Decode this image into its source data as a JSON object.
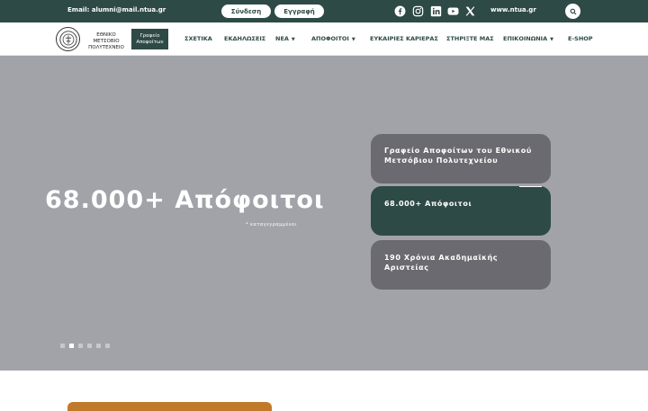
{
  "topbar": {
    "email": "Email: alumni@mail.ntua.gr",
    "login_label": "Σύνδεση",
    "register_label": "Εγγραφή",
    "social_icons": [
      "facebook-icon",
      "instagram-icon",
      "linkedin-icon",
      "youtube-icon",
      "x-icon"
    ],
    "website": "www.ntua.gr"
  },
  "logo": {
    "line1": "ΕΘΝΙΚΟ ΜΕΤΣΟΒΙΟ",
    "line2": "ΠΟΛΥΤΕΧΝΕΙΟ",
    "badge_line1": "Γραφείο",
    "badge_line2": "Αποφοίτων"
  },
  "nav": {
    "items": [
      {
        "label": "ΣΧΕΤΙΚΑ",
        "dropdown": false
      },
      {
        "label": "ΕΚΔΗΛΩΣΕΙΣ",
        "dropdown": false
      },
      {
        "label": "ΝΕΑ",
        "dropdown": true
      },
      {
        "label": "ΑΠΟΦΟΙΤΟΙ",
        "dropdown": true
      },
      {
        "label": "ΕΥΚΑΙΡΙΕΣ ΚΑΡΙΕΡΑΣ",
        "dropdown": false
      },
      {
        "label": "ΣΤΗΡΙΞΤΕ ΜΑΣ",
        "dropdown": false
      },
      {
        "label": "ΕΠΙΚΟΙΝΩΝΙΑ",
        "dropdown": true
      },
      {
        "label": "E-SHOP",
        "dropdown": false
      }
    ],
    "caret": "▼"
  },
  "hero": {
    "title": "68.000+ Απόφοιτοι",
    "note": "* καταγεγραμμένοι",
    "slide_count": 6,
    "active_slide": 2,
    "cards": [
      {
        "text": "Γραφείο Αποφοίτων του Εθνικού Μετσόβιου Πολυτεχνείου",
        "active": false
      },
      {
        "text": "68.000+ Απόφοιτοι",
        "active": true
      },
      {
        "text": "190 Χρόνια Ακαδημαϊκής Αριστείας",
        "active": false
      }
    ]
  },
  "colors": {
    "brand": "#2e4a46",
    "hero_bg": "#a1a3a9",
    "card_bg": "#6a6a70"
  }
}
